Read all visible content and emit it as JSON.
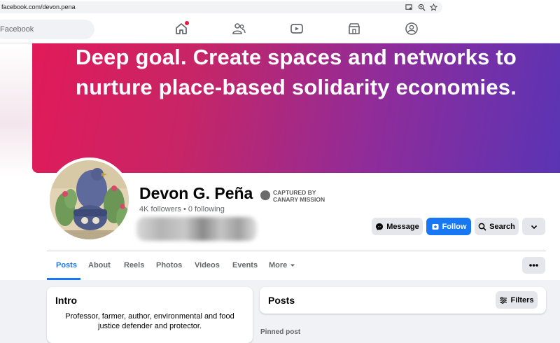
{
  "browser": {
    "url": "facebook.com/devon.pena",
    "icons": [
      "install-app-icon",
      "zoom-icon",
      "bookmark-star-icon"
    ]
  },
  "nav": {
    "search_placeholder": "Facebook",
    "icons": [
      "home-icon",
      "friends-icon",
      "video-icon",
      "marketplace-icon",
      "groups-icon"
    ]
  },
  "cover": {
    "line1": "Deep goal. Create spaces and networks to",
    "line2": "nurture place-based solidarity economies."
  },
  "profile": {
    "name": "Devon G. Peña",
    "followers_text": "4K followers • 0 following",
    "stamp_line1": "CAPTURED BY",
    "stamp_line2": "CANARY MISSION"
  },
  "actions": {
    "message": "Message",
    "follow": "Follow",
    "search": "Search"
  },
  "tabs": [
    "Posts",
    "About",
    "Reels",
    "Photos",
    "Videos",
    "Events",
    "More"
  ],
  "intro": {
    "title": "Intro",
    "bio": "Professor, farmer, author, environmental and food justice defender and protector."
  },
  "posts": {
    "title": "Posts",
    "filters": "Filters",
    "pinned": "Pinned post"
  },
  "colors": {
    "accent": "#1877f2",
    "cover_start": "#e11a59",
    "cover_end": "#5a34b5"
  }
}
